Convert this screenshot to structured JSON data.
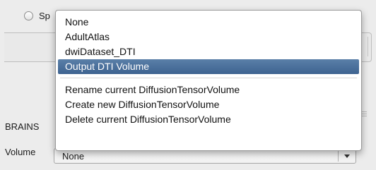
{
  "background": {
    "radio_label": "Sp",
    "brains_label": "BRAINS",
    "volume_label": "Volume",
    "combo_value": "None"
  },
  "menu": {
    "options": [
      "None",
      "AdultAtlas",
      "dwiDataset_DTI",
      "Output DTI Volume"
    ],
    "selected_index": 3,
    "actions": [
      "Rename current DiffusionTensorVolume",
      "Create new DiffusionTensorVolume",
      "Delete current DiffusionTensorVolume"
    ]
  },
  "colors": {
    "selection": "#4a6f99",
    "window_bg": "#ececec"
  }
}
